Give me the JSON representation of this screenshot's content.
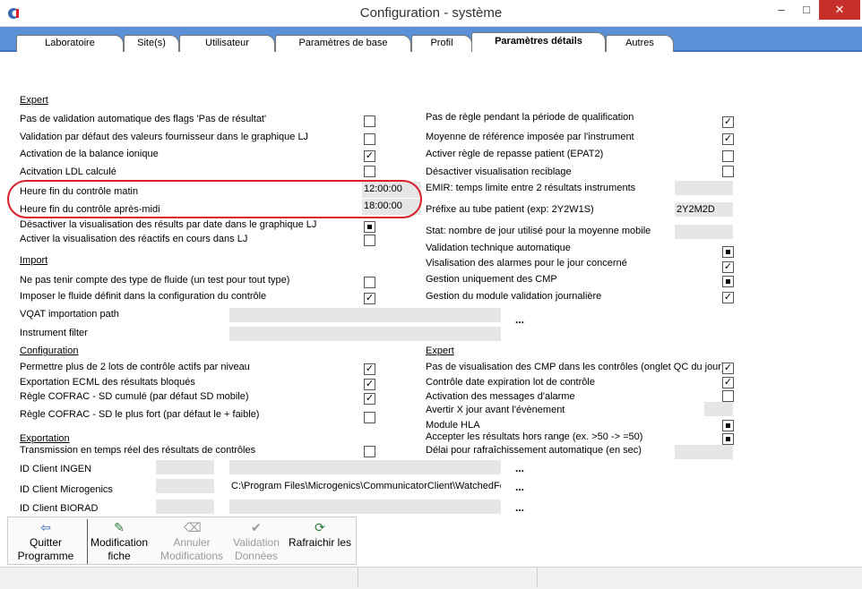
{
  "window": {
    "title": "Configuration - système",
    "minimize": "–",
    "maximize": "□",
    "close": "✕"
  },
  "colors": {
    "tabstrip": "#5b8fd6",
    "highlight_oval": "#d9212a"
  },
  "tabs": [
    "Laboratoire",
    "Site(s)",
    "Utilisateur",
    "Paramètres de base",
    "Profil",
    "Paramètres détails",
    "Autres"
  ],
  "sections": {
    "expert_left": "Expert",
    "import": "Import",
    "configuration": "Configuration",
    "exportation": "Exportation",
    "expert_right": "Expert"
  },
  "left_options": [
    {
      "label": "Pas de validation automatique des flags 'Pas de résultat'",
      "state": "unchecked"
    },
    {
      "label": "Validation par défaut des valeurs fournisseur dans le graphique LJ",
      "state": "unchecked"
    },
    {
      "label": "Activation de la balance ionique",
      "state": "checked"
    },
    {
      "label": "Acitvation LDL calculé",
      "state": "unchecked"
    },
    {
      "label": "Heure fin du contrôle matin",
      "value": "12:00:00"
    },
    {
      "label": "Heure fin du contrôle après-midi",
      "value": "18:00:00"
    },
    {
      "label": "Désactiver la visualisation des résults par date dans le graphique LJ",
      "state": "indeterminate"
    },
    {
      "label": "Activer la visualisation des réactifs en cours dans LJ",
      "state": "unchecked"
    }
  ],
  "import_options": [
    {
      "label": "Ne pas tenir compte des type de fluide (un test pour tout type)",
      "state": "unchecked"
    },
    {
      "label": "Imposer le fluide définit dans la configuration du contrôle",
      "state": "checked"
    },
    {
      "label": "VQAT importation path",
      "value": "",
      "browse": "..."
    },
    {
      "label": "Instrument filter",
      "value": ""
    }
  ],
  "config_options": [
    {
      "label": "Permettre plus de 2 lots de contrôle actifs par niveau",
      "state": "checked"
    },
    {
      "label": "Exportation ECML des résultats bloqués",
      "state": "checked"
    },
    {
      "label": "Règle COFRAC - SD cumulé (par défaut SD mobile)",
      "state": "checked"
    },
    {
      "label": "Règle COFRAC - SD le plus fort (par défaut le + faible)",
      "state": "unchecked"
    }
  ],
  "export_options": [
    {
      "label": "Transmission en temps réel des résultats de contrôles",
      "state": "unchecked"
    },
    {
      "label": "ID Client INGEN",
      "id": "",
      "path": "",
      "browse": "..."
    },
    {
      "label": "ID Client Microgenics",
      "id": "",
      "path": "C:\\Program Files\\Microgenics\\CommunicatorClient\\WatchedFold",
      "browse": "..."
    },
    {
      "label": "ID Client BIORAD",
      "id": "",
      "path": "",
      "browse": "..."
    }
  ],
  "right_options": [
    {
      "label": "Pas de règle pendant la période de qualification",
      "state": "checked"
    },
    {
      "label": "Moyenne de référence imposée par l'instrument",
      "state": "checked"
    },
    {
      "label": "Activer règle de repasse patient (EPAT2)",
      "state": "unchecked"
    },
    {
      "label": "Désactiver visualisation reciblage",
      "state": "unchecked"
    },
    {
      "label": "EMIR: temps limite entre 2 résultats instruments",
      "value": ""
    },
    {
      "label": "Préfixe au tube patient (exp: 2Y2W1S)",
      "value": "2Y2M2D"
    },
    {
      "label": "Stat: nombre de jour utilisé pour la moyenne mobile",
      "value": ""
    },
    {
      "label": "Validation technique automatique",
      "state": "indeterminate"
    },
    {
      "label": "Visalisation des alarmes pour le jour concerné",
      "state": "checked"
    },
    {
      "label": "Gestion uniquement des CMP",
      "state": "indeterminate"
    },
    {
      "label": "Gestion du module validation journalière",
      "state": "checked"
    }
  ],
  "expert_right_options": [
    {
      "label": "Pas  de visualisation des CMP dans les contrôles (onglet QC du jour)",
      "state": "checked"
    },
    {
      "label": "Contrôle date expiration lot de contrôle",
      "state": "checked"
    },
    {
      "label": "Activation des messages d'alarme",
      "state": "unchecked"
    },
    {
      "label": "Avertir X jour avant l'évènement",
      "value": ""
    },
    {
      "label": "Module HLA",
      "state": "indeterminate"
    },
    {
      "label": "Accepter les résultats hors range (ex. >50 -> =50)",
      "state": "indeterminate"
    },
    {
      "label": "Délai pour rafraîchissement automatique (en sec)",
      "value": ""
    }
  ],
  "toolbar": [
    {
      "line1": "Quitter",
      "line2": "Programme",
      "icon": "arrow-left-icon",
      "glyph": "⇦",
      "enabled": true
    },
    {
      "line1": "Modification",
      "line2": "fiche",
      "icon": "edit-document-icon",
      "glyph": "✎",
      "enabled": true
    },
    {
      "line1": "Annuler",
      "line2": "Modifications",
      "icon": "eraser-icon",
      "glyph": "⌫",
      "enabled": false
    },
    {
      "line1": "Validation",
      "line2": "Données",
      "icon": "checkmark-circle-icon",
      "glyph": "✔",
      "enabled": false
    },
    {
      "line1": "Rafraichir les",
      "line2": "",
      "icon": "refresh-icon",
      "glyph": "⟳",
      "enabled": true
    }
  ]
}
